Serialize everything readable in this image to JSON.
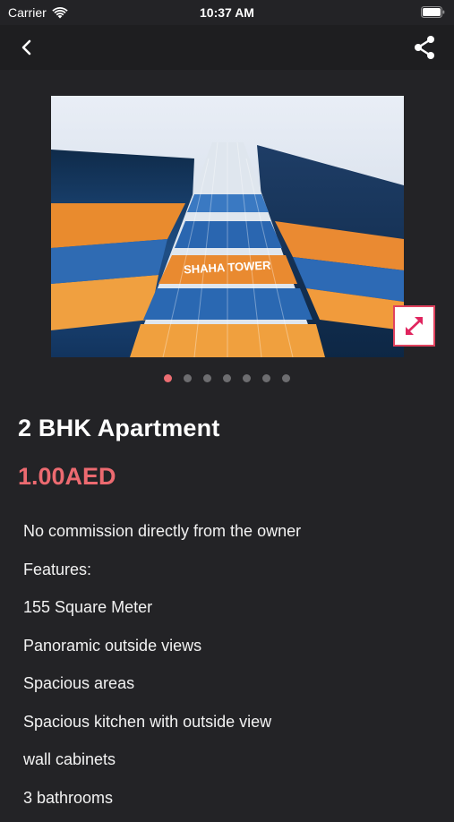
{
  "status_bar": {
    "carrier": "Carrier",
    "time": "10:37 AM"
  },
  "nav": {
    "back_icon": "chevron-left-icon",
    "share_icon": "share-icon"
  },
  "gallery": {
    "image_count": 7,
    "active_index": 0,
    "image_text": "SHAHA TOWER",
    "expand_icon": "expand-arrows-icon"
  },
  "listing": {
    "title": "2 BHK Apartment",
    "price": "1.00AED",
    "description": [
      "No commission directly from the owner",
      "Features:",
      "155 Square Meter",
      "Panoramic outside views",
      "Spacious areas",
      "Spacious kitchen with outside view",
      "wall cabinets",
      "3 bathrooms"
    ]
  },
  "colors": {
    "background": "#232326",
    "nav": "#1e1e20",
    "accent": "#ec6a70",
    "dot_inactive": "#6d6d70"
  }
}
